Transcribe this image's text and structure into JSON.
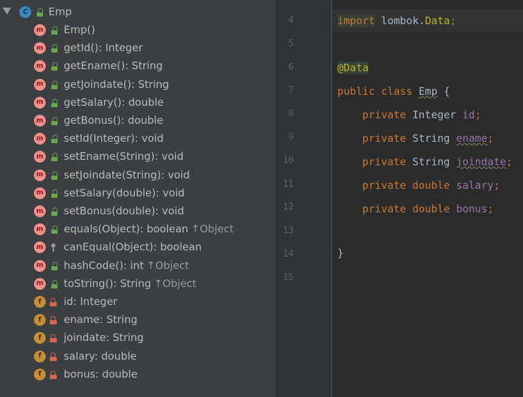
{
  "structure": {
    "root": {
      "kind": "C",
      "name": "Emp"
    },
    "members": [
      {
        "kind": "m",
        "vis": "public",
        "name": "Emp()",
        "inherit": ""
      },
      {
        "kind": "m",
        "vis": "public",
        "name": "getId(): Integer",
        "inherit": ""
      },
      {
        "kind": "m",
        "vis": "public",
        "name": "getEname(): String",
        "inherit": ""
      },
      {
        "kind": "m",
        "vis": "public",
        "name": "getJoindate(): String",
        "inherit": ""
      },
      {
        "kind": "m",
        "vis": "public",
        "name": "getSalary(): double",
        "inherit": ""
      },
      {
        "kind": "m",
        "vis": "public",
        "name": "getBonus(): double",
        "inherit": ""
      },
      {
        "kind": "m",
        "vis": "public",
        "name": "setId(Integer): void",
        "inherit": ""
      },
      {
        "kind": "m",
        "vis": "public",
        "name": "setEname(String): void",
        "inherit": ""
      },
      {
        "kind": "m",
        "vis": "public",
        "name": "setJoindate(String): void",
        "inherit": ""
      },
      {
        "kind": "m",
        "vis": "public",
        "name": "setSalary(double): void",
        "inherit": ""
      },
      {
        "kind": "m",
        "vis": "public",
        "name": "setBonus(double): void",
        "inherit": ""
      },
      {
        "kind": "m",
        "vis": "public",
        "name": "equals(Object): boolean",
        "inherit": "↑Object"
      },
      {
        "kind": "m",
        "vis": "protected",
        "name": "canEqual(Object): boolean",
        "inherit": ""
      },
      {
        "kind": "m",
        "vis": "public",
        "name": "hashCode(): int",
        "inherit": "↑Object"
      },
      {
        "kind": "m",
        "vis": "public",
        "name": "toString(): String",
        "inherit": "↑Object"
      },
      {
        "kind": "f",
        "vis": "private",
        "name": "id: Integer",
        "inherit": ""
      },
      {
        "kind": "f",
        "vis": "private",
        "name": "ename: String",
        "inherit": ""
      },
      {
        "kind": "f",
        "vis": "private",
        "name": "joindate: String",
        "inherit": ""
      },
      {
        "kind": "f",
        "vis": "private",
        "name": "salary: double",
        "inherit": ""
      },
      {
        "kind": "f",
        "vis": "private",
        "name": "bonus: double",
        "inherit": ""
      }
    ]
  },
  "editor": {
    "line_numbers": [
      "4",
      "5",
      "6",
      "7",
      "8",
      "9",
      "10",
      "11",
      "12",
      "13",
      "14",
      "15"
    ],
    "import_kw": "import",
    "import_pkg": "lombok.",
    "import_cls": "Data",
    "import_end": ";",
    "annotation": "@Data",
    "class_kw": "public class ",
    "class_name": "Emp",
    "class_open": " {",
    "fields": [
      {
        "kw": "private ",
        "type": "Integer ",
        "name": "id",
        "end": ";"
      },
      {
        "kw": "private ",
        "type": "String ",
        "name": "ename",
        "end": ";"
      },
      {
        "kw": "private ",
        "type": "String ",
        "name": "joindate",
        "end": ";"
      },
      {
        "kw": "private double ",
        "type": "",
        "name": "salary",
        "end": ";"
      },
      {
        "kw": "private double ",
        "type": "",
        "name": "bonus",
        "end": ";"
      }
    ],
    "class_close": "}"
  }
}
